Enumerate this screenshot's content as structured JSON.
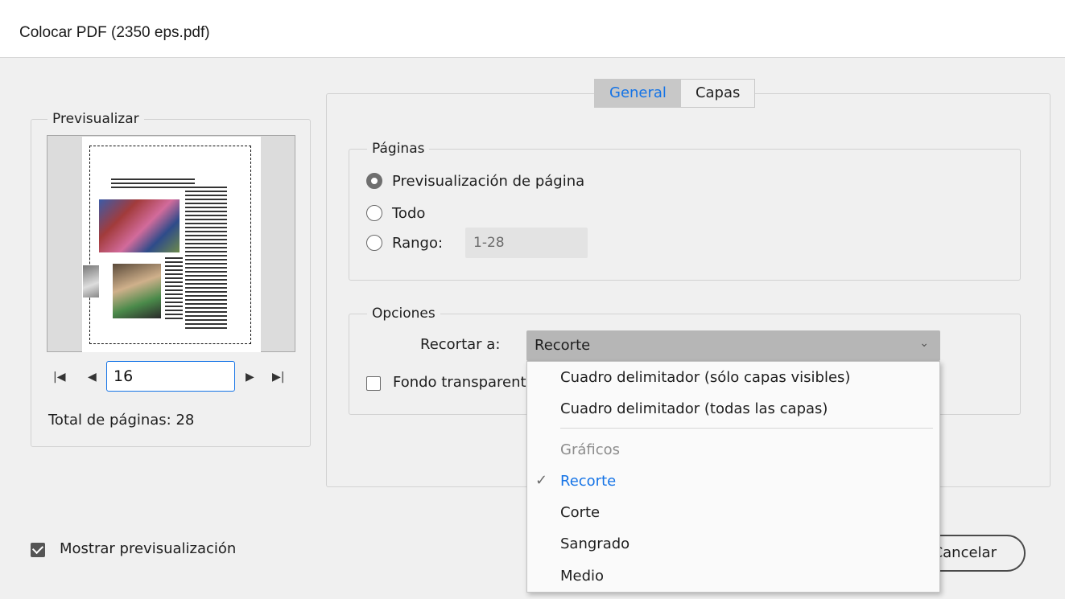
{
  "window": {
    "title": "Colocar PDF (2350 eps.pdf)"
  },
  "preview": {
    "legend": "Previsualizar",
    "page_input_value": "16",
    "total_label": "Total de páginas: 28",
    "nav": {
      "first": "⏮",
      "prev": "◀",
      "next": "▶",
      "last": "⏭"
    }
  },
  "tabs": [
    {
      "label": "General",
      "active": true
    },
    {
      "label": "Capas",
      "active": false
    }
  ],
  "pages": {
    "legend": "Páginas",
    "options": [
      {
        "label": "Previsualización de página",
        "checked": true
      },
      {
        "label": "Todo",
        "checked": false
      },
      {
        "label": "Rango:",
        "checked": false
      }
    ],
    "range_value": "1-28"
  },
  "options": {
    "legend": "Opciones",
    "crop_label": "Recortar a:",
    "crop_value": "Recorte",
    "transparent_label": "Fondo transparente",
    "transparent_checked": false
  },
  "dropdown": {
    "items": [
      {
        "label": "Cuadro delimitador (sólo capas visibles)",
        "state": "normal"
      },
      {
        "label": "Cuadro delimitador (todas las capas)",
        "state": "normal"
      },
      {
        "label": "Gráficos",
        "state": "disabled"
      },
      {
        "label": "Recorte",
        "state": "selected"
      },
      {
        "label": "Corte",
        "state": "normal"
      },
      {
        "label": "Sangrado",
        "state": "normal"
      },
      {
        "label": "Medio",
        "state": "normal"
      }
    ]
  },
  "footer": {
    "show_preview_label": "Mostrar previsualización",
    "show_preview_checked": true,
    "cancel_label": "Cancelar"
  },
  "colors": {
    "accent": "#1473e6",
    "background": "#f0f0f0"
  }
}
